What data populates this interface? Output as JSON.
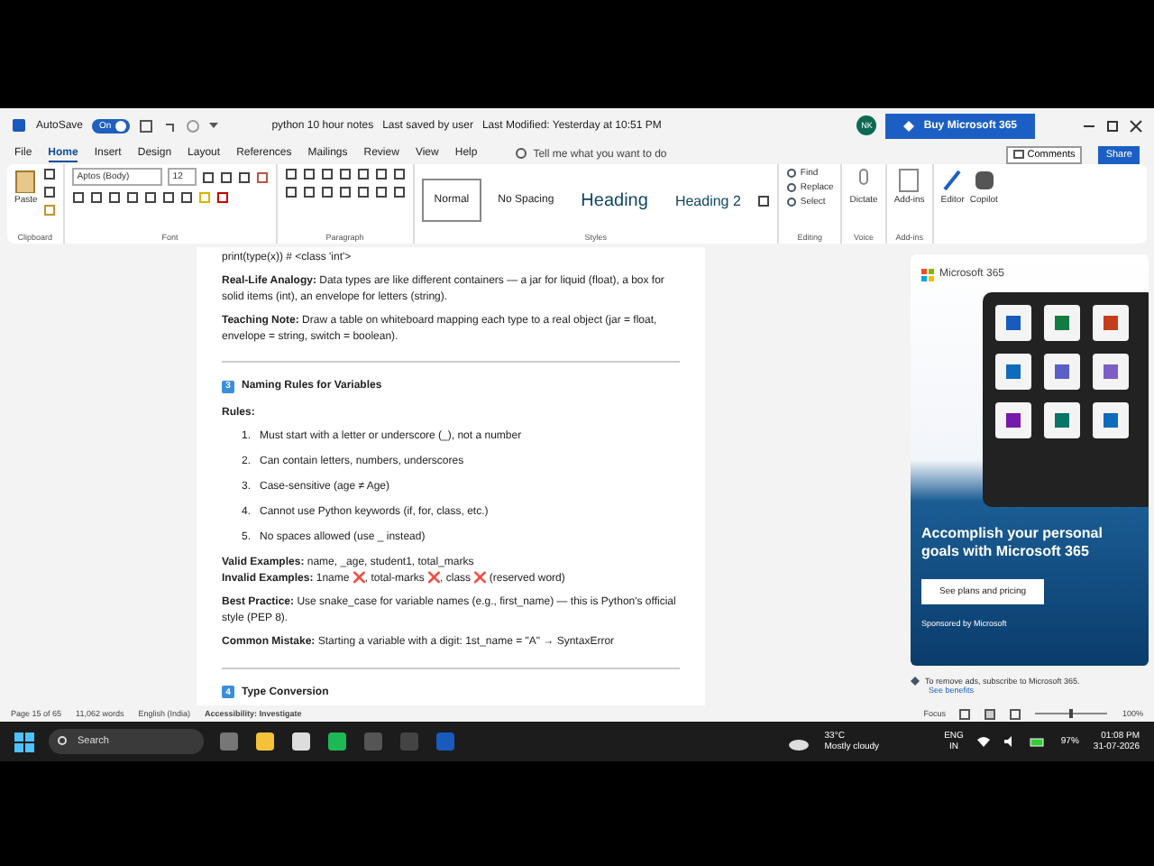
{
  "title_bar": {
    "autosave_label": "AutoSave",
    "autosave_toggle": {
      "label": "On",
      "on": true
    },
    "document_title": "python 10 hour notes",
    "save_status": "Last saved by user",
    "last_modified": "Last Modified: Yesterday at 10:51 PM",
    "avatar_initials": "NK",
    "buy_button": "Buy Microsoft 365"
  },
  "menu": {
    "tabs": [
      {
        "label": "File",
        "selected": false
      },
      {
        "label": "Home",
        "selected": true
      },
      {
        "label": "Insert",
        "selected": false
      },
      {
        "label": "Design",
        "selected": false
      },
      {
        "label": "Layout",
        "selected": false
      },
      {
        "label": "References",
        "selected": false
      },
      {
        "label": "Mailings",
        "selected": false
      },
      {
        "label": "Review",
        "selected": false
      },
      {
        "label": "View",
        "selected": false
      },
      {
        "label": "Help",
        "selected": false
      }
    ],
    "tell_me": "Tell me what you want to do",
    "comments": "Comments",
    "share": "Share"
  },
  "ribbon": {
    "paste": "Paste",
    "font_name": "Aptos (Body)",
    "font_size": "12",
    "styles": [
      {
        "label": "Normal",
        "kind": "normal",
        "selected": true
      },
      {
        "label": "No Spacing",
        "kind": "normal",
        "selected": false
      },
      {
        "label": "Heading",
        "kind": "heading1",
        "selected": false
      },
      {
        "label": "Heading 2",
        "kind": "heading2",
        "selected": false
      }
    ],
    "editing": [
      "Find",
      "Replace",
      "Select"
    ],
    "dictate": "Dictate",
    "addins": "Add-ins",
    "editor": "Editor",
    "copilot": "Copilot",
    "group_labels": [
      "Clipboard",
      "Font",
      "Paragraph",
      "Styles",
      "Editing",
      "Voice",
      "Add-ins"
    ]
  },
  "document": {
    "blocks": [
      {
        "kind": "code",
        "text": "print(type(x)) # <class 'int'>"
      },
      {
        "kind": "para",
        "text": "**Real-Life Analogy:** Data types are like different containers — a jar for liquid (float), a box for solid items (int), an envelope for letters (string)."
      },
      {
        "kind": "para",
        "text": "**Teaching Note:** Draw a table on whiteboard mapping each type to a real object (jar = float, envelope = string, switch = boolean)."
      },
      {
        "kind": "rule"
      },
      {
        "kind": "heading",
        "number": "3",
        "text": "Naming Rules for Variables"
      },
      {
        "kind": "label",
        "text": "Rules:"
      },
      {
        "kind": "list",
        "items": [
          {
            "number": "1.",
            "text": "Must start with a letter or underscore (_), not a number"
          },
          {
            "number": "2.",
            "text": "Can contain letters, numbers, underscores"
          },
          {
            "number": "3.",
            "text": "Case-sensitive (age ≠ Age)"
          },
          {
            "number": "4.",
            "text": "Cannot use Python keywords (if, for, class, etc.)"
          },
          {
            "number": "5.",
            "text": "No spaces allowed (use _ instead)"
          }
        ]
      },
      {
        "kind": "tight",
        "text": "**Valid Examples:** name, _age, student1, total_marks"
      },
      {
        "kind": "para",
        "text": "**Invalid Examples:** 1name ❌, total-marks ❌, class ❌ (reserved word)"
      },
      {
        "kind": "para",
        "text": "**Best Practice:** Use snake_case for variable names (e.g., first_name) — this is Python's official style (PEP 8)."
      },
      {
        "kind": "para",
        "text": "**Common Mistake:** Starting a variable with a digit: 1st_name = \"A\" → SyntaxError"
      },
      {
        "kind": "rule"
      },
      {
        "kind": "heading",
        "number": "4",
        "text": "Type Conversion"
      }
    ]
  },
  "ad_pane": {
    "brand": "Microsoft 365",
    "headline": "Accomplish your personal goals with Microsoft 365",
    "button": "See plans and pricing",
    "sponsor": "Sponsored by Microsoft",
    "note": "To remove ads, subscribe to Microsoft 365.",
    "link": "See benefits"
  },
  "status_bar": {
    "page": "Page 15 of 65",
    "words": "11,062 words",
    "language": "English (India)",
    "accessibility": "Accessibility: Investigate",
    "focus": "Focus",
    "zoom": "100%",
    "zoom_slider": {
      "level": 0.5
    }
  },
  "taskbar": {
    "search": "Search",
    "temperature": "33°C",
    "weather": "Mostly cloudy",
    "lang_top": "ENG",
    "lang_bottom": "IN",
    "battery": "97%",
    "time": "01:08 PM",
    "date": "31-07-2026"
  }
}
